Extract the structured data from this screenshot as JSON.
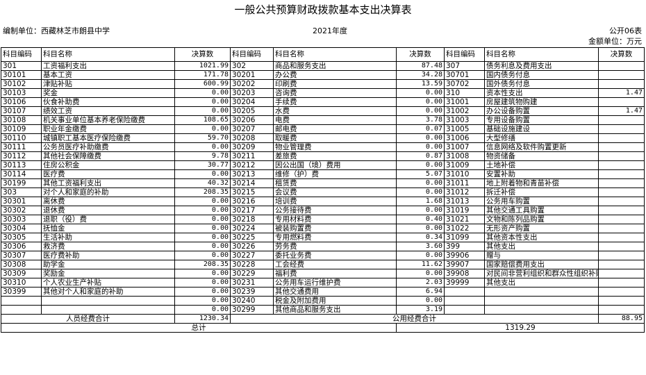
{
  "title": "一般公共预算财政拨款基本支出决算表",
  "unit": "编制单位：西藏林芝市朗县中学",
  "year": "2021年度",
  "code": "公开06表",
  "money_unit": "金额单位：万元",
  "headers": {
    "code": "科目编码",
    "name": "科目名称",
    "amount": "决算数"
  },
  "rows": [
    [
      [
        "301",
        "工资福利支出",
        false
      ],
      "1021.99",
      [
        "302",
        "商品和服务支出",
        false
      ],
      "87.48",
      [
        "307",
        "债务利息及费用支出",
        false
      ],
      ""
    ],
    [
      [
        "30101",
        "基本工资",
        true
      ],
      "171.78",
      [
        "30201",
        "办公费",
        true
      ],
      "34.28",
      [
        "30701",
        "国内债务付息",
        false
      ],
      ""
    ],
    [
      [
        "30102",
        "津贴补贴",
        true
      ],
      "600.99",
      [
        "30202",
        "印刷费",
        true
      ],
      "13.59",
      [
        "30702",
        "国外债务付息",
        false
      ],
      ""
    ],
    [
      [
        "30103",
        "奖金",
        true
      ],
      "0.00",
      [
        "30203",
        "咨询费",
        true
      ],
      "0.00",
      [
        "310",
        "资本性支出",
        false
      ],
      "1.47"
    ],
    [
      [
        "30106",
        "伙食补助费",
        true
      ],
      "0.00",
      [
        "30204",
        "手续费",
        true
      ],
      "0.00",
      [
        "31001",
        "房屋建筑物购建",
        true
      ],
      ""
    ],
    [
      [
        "30107",
        "绩效工资",
        true
      ],
      "0.00",
      [
        "30205",
        "水费",
        true
      ],
      "0.00",
      [
        "31002",
        "办公设备购置",
        true
      ],
      "1.47"
    ],
    [
      [
        "30108",
        "机关事业单位基本养老保险缴费",
        true
      ],
      "108.65",
      [
        "30206",
        "电费",
        true
      ],
      "3.78",
      [
        "31003",
        "专用设备购置",
        true
      ],
      ""
    ],
    [
      [
        "30109",
        "职业年金缴费",
        true
      ],
      "0.00",
      [
        "30207",
        "邮电费",
        true
      ],
      "0.07",
      [
        "31005",
        "基础设施建设",
        true
      ],
      ""
    ],
    [
      [
        "30110",
        "城镇职工基本医疗保险缴费",
        true
      ],
      "59.70",
      [
        "30208",
        "取暖费",
        true
      ],
      "0.00",
      [
        "31006",
        "大型修缮",
        true
      ],
      ""
    ],
    [
      [
        "30111",
        "公务员医疗补助缴费",
        true
      ],
      "0.00",
      [
        "30209",
        "物业管理费",
        true
      ],
      "0.00",
      [
        "31007",
        "信息网络及软件购置更新",
        true
      ],
      ""
    ],
    [
      [
        "30112",
        "其他社会保障缴费",
        true
      ],
      "9.78",
      [
        "30211",
        "差旅费",
        true
      ],
      "0.87",
      [
        "31008",
        "物资储备",
        true
      ],
      ""
    ],
    [
      [
        "30113",
        "住房公积金",
        true
      ],
      "30.77",
      [
        "30212",
        "因公出国（境）费用",
        true
      ],
      "0.00",
      [
        "31009",
        "土地补偿",
        true
      ],
      ""
    ],
    [
      [
        "30114",
        "医疗费",
        true
      ],
      "0.00",
      [
        "30213",
        "维修（护）费",
        true
      ],
      "5.07",
      [
        "31010",
        "安置补助",
        true
      ],
      ""
    ],
    [
      [
        "30199",
        "其他工资福利支出",
        true
      ],
      "40.32",
      [
        "30214",
        "租赁费",
        true
      ],
      "0.00",
      [
        "31011",
        "地上附着物和青苗补偿",
        true
      ],
      ""
    ],
    [
      [
        "303",
        "对个人和家庭的补助",
        false
      ],
      "208.35",
      [
        "30215",
        "会议费",
        true
      ],
      "0.00",
      [
        "31012",
        "拆迁补偿",
        false
      ],
      ""
    ],
    [
      [
        "30301",
        "离休费",
        true
      ],
      "0.00",
      [
        "30216",
        "培训费",
        true
      ],
      "1.68",
      [
        "31013",
        "公务用车购置",
        true
      ],
      ""
    ],
    [
      [
        "30302",
        "退休费",
        true
      ],
      "0.00",
      [
        "30217",
        "公务接待费",
        true
      ],
      "0.00",
      [
        "31019",
        "其他交通工具购置",
        true
      ],
      ""
    ],
    [
      [
        "30303",
        "退职（役）费",
        true
      ],
      "0.00",
      [
        "30218",
        "专用材料费",
        true
      ],
      "0.40",
      [
        "31021",
        "文物和陈列品购置",
        true
      ],
      ""
    ],
    [
      [
        "30304",
        "抚恤金",
        true
      ],
      "0.00",
      [
        "30224",
        "被装购置费",
        true
      ],
      "0.00",
      [
        "31022",
        "无形资产购置",
        true
      ],
      ""
    ],
    [
      [
        "30305",
        "生活补助",
        true
      ],
      "0.00",
      [
        "30225",
        "专用燃料费",
        true
      ],
      "0.34",
      [
        "31099",
        "其他资本性支出",
        true
      ],
      ""
    ],
    [
      [
        "30306",
        "救济费",
        true
      ],
      "0.00",
      [
        "30226",
        "劳务费",
        true
      ],
      "3.60",
      [
        "399",
        "其他支出",
        false
      ],
      ""
    ],
    [
      [
        "30307",
        "医疗费补助",
        true
      ],
      "0.00",
      [
        "30227",
        "委托业务费",
        true
      ],
      "0.00",
      [
        "39906",
        "赠与",
        true
      ],
      ""
    ],
    [
      [
        "30308",
        "助学金",
        true
      ],
      "208.35",
      [
        "30228",
        "工会经费",
        true
      ],
      "11.62",
      [
        "39907",
        "国家赔偿费用支出",
        true
      ],
      ""
    ],
    [
      [
        "30309",
        "奖励金",
        true
      ],
      "0.00",
      [
        "30229",
        "福利费",
        true
      ],
      "0.00",
      [
        "39908",
        "对民间非营利组织和群众性组织补贴",
        false
      ],
      ""
    ],
    [
      [
        "30310",
        "个人农业生产补贴",
        true
      ],
      "0.00",
      [
        "30231",
        "公务用车运行维护费",
        true
      ],
      "2.03",
      [
        "39999",
        "其他支出",
        true
      ],
      ""
    ],
    [
      [
        "30399",
        "其他对个人和家庭的补助",
        true
      ],
      "0.00",
      [
        "30239",
        "其他交通费用",
        true
      ],
      "6.94",
      [
        "",
        "",
        false
      ],
      ""
    ],
    [
      [
        "",
        "",
        false
      ],
      "0.00",
      [
        "30240",
        "税金及附加费用",
        true
      ],
      "0.00",
      [
        "",
        "",
        false
      ],
      ""
    ],
    [
      [
        "",
        "",
        false
      ],
      "0.00",
      [
        "30299",
        "其他商品和服务支出",
        true
      ],
      "3.19",
      [
        "",
        "",
        false
      ],
      ""
    ]
  ],
  "footer": {
    "personnel_label": "人员经费合计",
    "personnel_value": "1230.34",
    "public_label": "公用经费合计",
    "public_value": "88.95",
    "total_label": "总计",
    "total_value": "1319.29"
  }
}
